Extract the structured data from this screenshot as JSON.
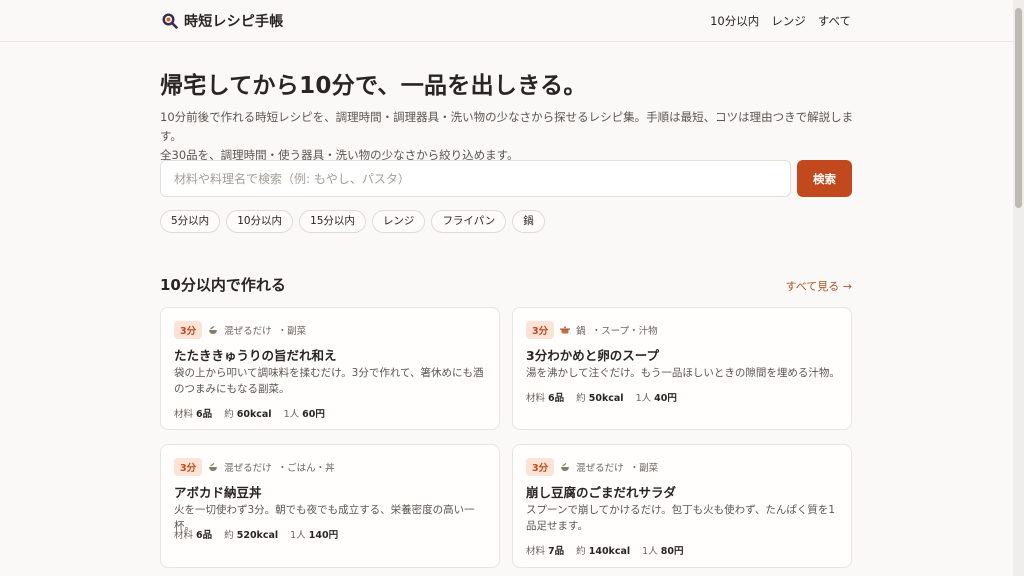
{
  "header": {
    "site_title": "時短レシピ手帳",
    "nav": [
      "10分以内",
      "レンジ",
      "すべて"
    ]
  },
  "hero": {
    "title": "帰宅してから10分で、一品を出しきる。",
    "desc_line1": "10分前後で作れる時短レシピを、調理時間・調理器具・洗い物の少なさから探せるレシピ集。手順は最短、コツは理由つきで解説します。",
    "desc_line2": "全30品を、調理時間・使う器具・洗い物の少なさから絞り込めます。"
  },
  "search": {
    "placeholder": "材料や料理名で検索（例: もやし、パスタ）",
    "value": "",
    "button_label": "検索"
  },
  "filters": [
    "5分以内",
    "10分以内",
    "15分以内",
    "レンジ",
    "フライパン",
    "鍋"
  ],
  "section": {
    "title": "10分以内で作れる",
    "see_all": "すべて見る →"
  },
  "colors": {
    "accent": "#c2491d",
    "badge_bg": "#fbe3d5",
    "background": "#faf9f7"
  },
  "recipes": [
    {
      "time": "3分",
      "tool": "混ぜるだけ",
      "tool_icon": "bowl-icon",
      "category": "・副菜",
      "title": "たたききゅうりの旨だれ和え",
      "desc": "袋の上から叩いて調味料を揉むだけ。3分で作れて、箸休めにも酒のつまみにもなる副菜。",
      "ingredients_label": "材料",
      "ingredients": "6品",
      "kcal_label": "約",
      "kcal": "60kcal",
      "price_label": "1人",
      "price": "60円"
    },
    {
      "time": "3分",
      "tool": "鍋",
      "tool_icon": "pot-icon",
      "category": "・スープ・汁物",
      "title": "3分わかめと卵のスープ",
      "desc": "湯を沸かして注ぐだけ。もう一品ほしいときの隙間を埋める汁物。",
      "ingredients_label": "材料",
      "ingredients": "6品",
      "kcal_label": "約",
      "kcal": "50kcal",
      "price_label": "1人",
      "price": "40円"
    },
    {
      "time": "3分",
      "tool": "混ぜるだけ",
      "tool_icon": "bowl-icon",
      "category": "・ごはん・丼",
      "title": "アボカド納豆丼",
      "desc": "火を一切使わず3分。朝でも夜でも成立する、栄養密度の高い一杯。",
      "ingredients_label": "材料",
      "ingredients": "6品",
      "kcal_label": "約",
      "kcal": "520kcal",
      "price_label": "1人",
      "price": "140円"
    },
    {
      "time": "3分",
      "tool": "混ぜるだけ",
      "tool_icon": "bowl-icon",
      "category": "・副菜",
      "title": "崩し豆腐のごまだれサラダ",
      "desc": "スプーンで崩してかけるだけ。包丁も火も使わず、たんぱく質を1品足せます。",
      "ingredients_label": "材料",
      "ingredients": "7品",
      "kcal_label": "約",
      "kcal": "140kcal",
      "price_label": "1人",
      "price": "80円"
    }
  ]
}
